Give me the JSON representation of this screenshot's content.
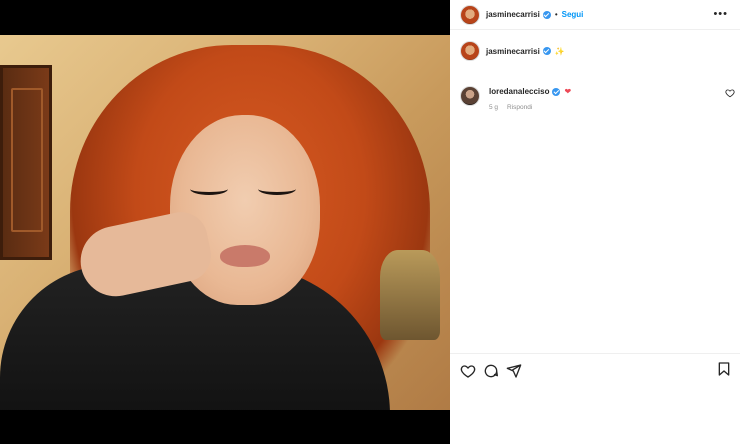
{
  "post": {
    "author": "jasminecarrisi",
    "separator": "•",
    "follow_label": "Segui",
    "more_label": "•••"
  },
  "caption": {
    "author": "jasminecarrisi",
    "emoji": "✨"
  },
  "comments": [
    {
      "author": "loredanalecciso",
      "emoji": "❤",
      "time": "5 g",
      "reply_label": "Rispondi"
    }
  ],
  "icons": {
    "like": "heart-outline-icon",
    "comment": "comment-bubble-icon",
    "share": "paper-plane-icon",
    "save": "bookmark-icon",
    "verified": "verified-badge-icon",
    "more": "ellipsis-icon"
  },
  "colors": {
    "accent": "#0095f6",
    "verified": "#3897f0",
    "heart": "#ed4956",
    "text": "#262626",
    "muted": "#8e8e8e"
  }
}
